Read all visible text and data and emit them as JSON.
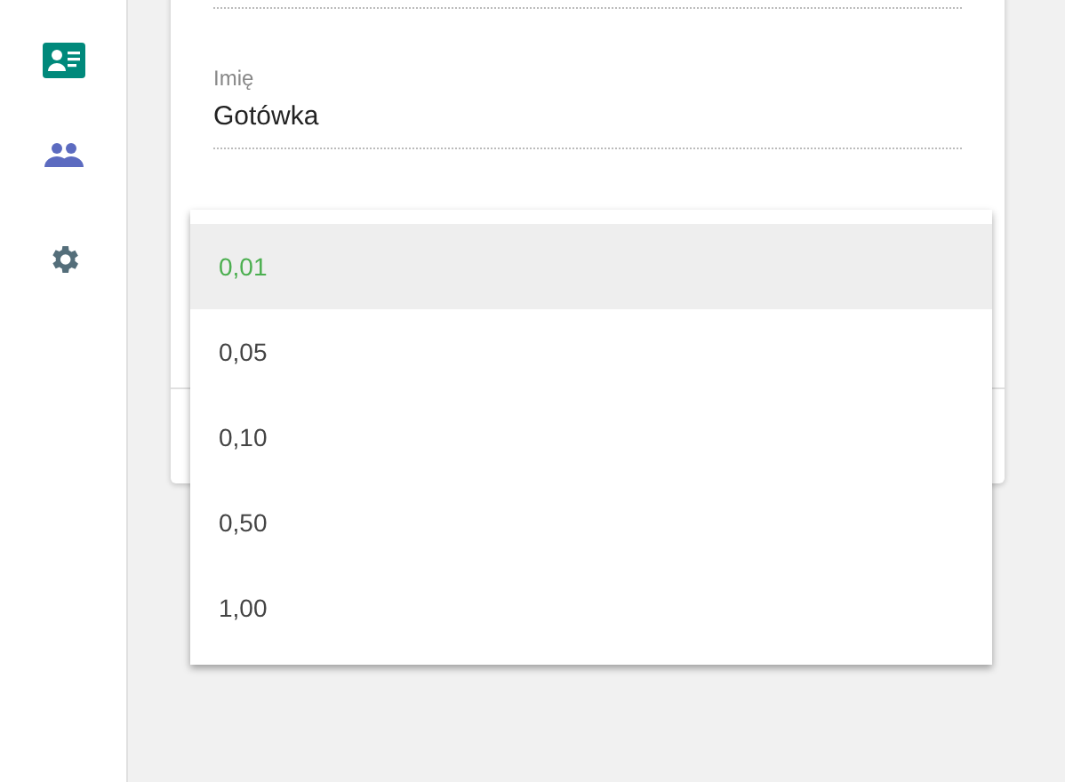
{
  "sidebar": {
    "items": [
      {
        "kind": "contact",
        "color": "#00897b"
      },
      {
        "kind": "people",
        "color": "#5c6bc0"
      },
      {
        "kind": "settings",
        "color": "#546e7a"
      }
    ]
  },
  "form": {
    "fields": [
      {
        "label": "Imię",
        "value": "Gotówka"
      }
    ]
  },
  "dropdown": {
    "options": [
      {
        "label": "0,01",
        "selected": true
      },
      {
        "label": "0,05",
        "selected": false
      },
      {
        "label": "0,10",
        "selected": false
      },
      {
        "label": "0,50",
        "selected": false
      },
      {
        "label": "1,00",
        "selected": false
      }
    ]
  }
}
